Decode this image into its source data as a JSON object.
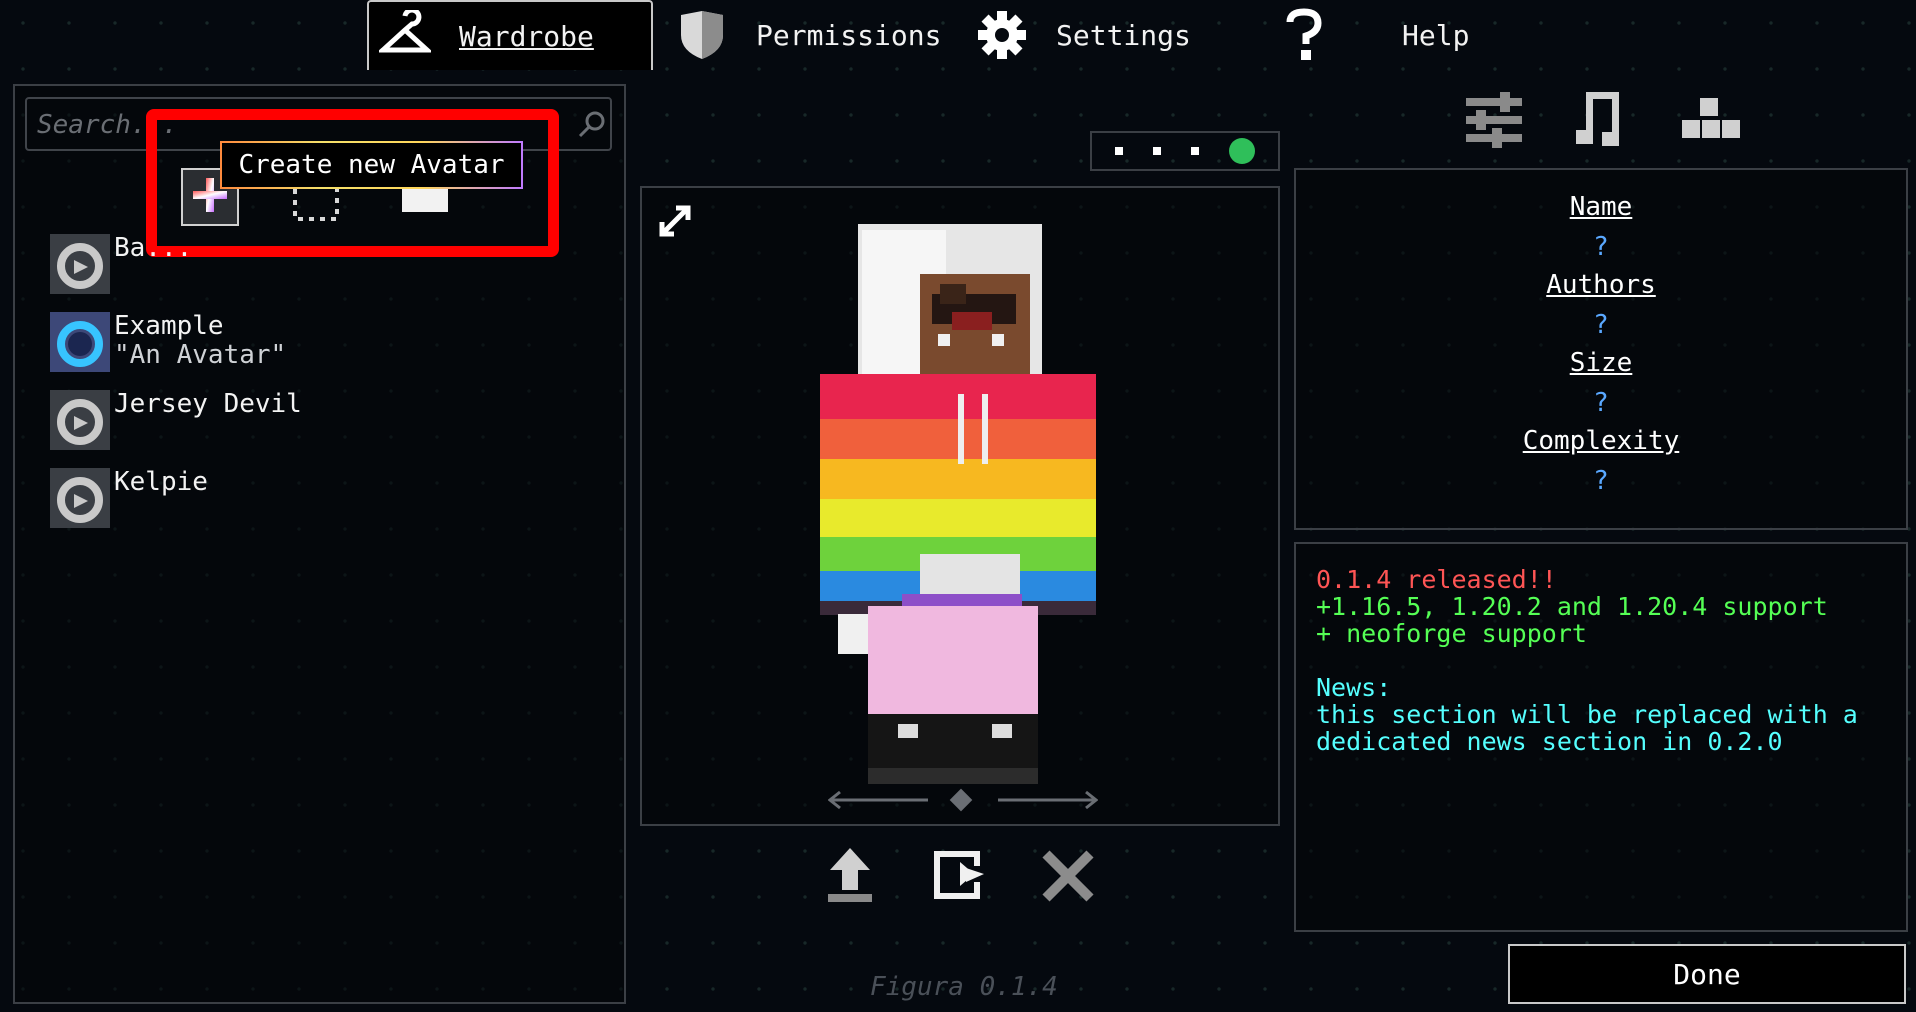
{
  "tabs": [
    {
      "label": "Wardrobe",
      "icon": "hanger-icon"
    },
    {
      "label": "Permissions",
      "icon": "shield-icon"
    },
    {
      "label": "Settings",
      "icon": "gear-icon"
    },
    {
      "label": "Help",
      "icon": "question-icon"
    }
  ],
  "search": {
    "placeholder": "Search..."
  },
  "tooltip": "Create new Avatar",
  "avatars": [
    {
      "name": "Ba...",
      "desc": ""
    },
    {
      "name": "Example",
      "desc": "\"An Avatar\""
    },
    {
      "name": "Jersey Devil",
      "desc": ""
    },
    {
      "name": "Kelpie",
      "desc": ""
    }
  ],
  "info": {
    "name_label": "Name",
    "name_value": "?",
    "authors_label": "Authors",
    "authors_value": "?",
    "size_label": "Size",
    "size_value": "?",
    "complexity_label": "Complexity",
    "complexity_value": "?"
  },
  "news": {
    "line1": "0.1.4 released!!",
    "line2": "+1.16.5, 1.20.2 and 1.20.4 support",
    "line3": "+ neoforge support",
    "line4": "News:",
    "line5": "this section will be replaced with a",
    "line6": "dedicated news section in 0.2.0"
  },
  "version": "Figura 0.1.4",
  "done_label": "Done",
  "colors": {
    "highlight": "#ff0000",
    "status_green": "#2fbf5a",
    "news_red": "#ff5555",
    "news_green": "#55ff55",
    "news_cyan": "#55ffff",
    "info_value": "#5aa8ff"
  }
}
